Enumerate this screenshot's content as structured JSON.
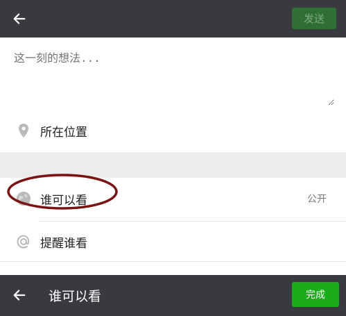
{
  "top_bar": {
    "back_icon": "arrow-left-icon",
    "send_label": "发送"
  },
  "compose": {
    "placeholder": "这一刻的想法..."
  },
  "location_row": {
    "icon": "location-pin-icon",
    "label": "所在位置"
  },
  "visibility_row": {
    "icon": "globe-icon",
    "label": "谁可以看",
    "value": "公开"
  },
  "mention_row": {
    "icon": "at-icon",
    "label": "提醒谁看"
  },
  "bottom_bar": {
    "back_icon": "arrow-left-icon",
    "title": "谁可以看",
    "done_label": "完成"
  },
  "colors": {
    "bar_bg": "#393a3f",
    "accent_green": "#1aad19",
    "annotation_red": "#7a1414"
  }
}
